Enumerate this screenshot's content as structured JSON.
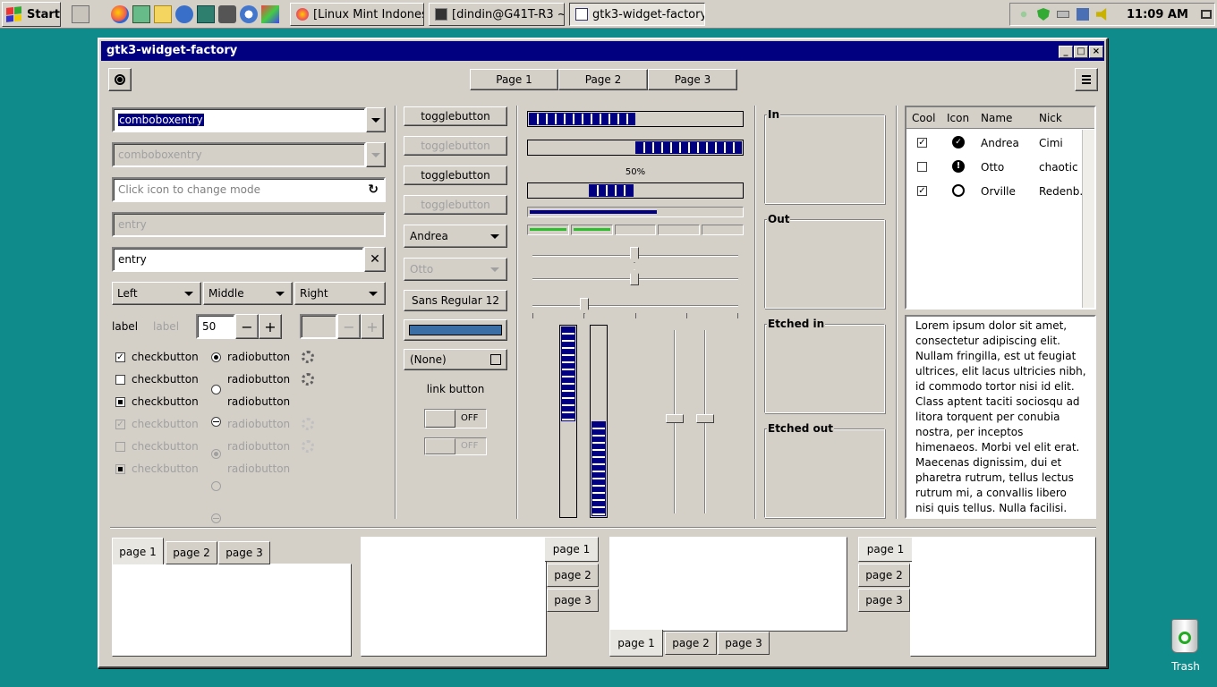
{
  "taskbar": {
    "start_label": "Start",
    "tasks": [
      {
        "label": "[Linux Mint Indonesi..."
      },
      {
        "label": "[dindin@G41T-R3 ~]"
      },
      {
        "label": "gtk3-widget-factory"
      }
    ],
    "clock": "11:09 AM"
  },
  "window": {
    "title": "gtk3-widget-factory",
    "header_tabs": [
      "Page 1",
      "Page 2",
      "Page 3"
    ]
  },
  "col1": {
    "combo1_value": "comboboxentry",
    "combo2_value": "comboboxentry",
    "entry_placeholder": "Click icon to change mode",
    "entry_disabled": "entry",
    "entry_value": "entry",
    "combos": [
      "Left",
      "Middle",
      "Right"
    ],
    "label1": "label",
    "label2": "label",
    "spin_value": "50",
    "minus": "−",
    "plus": "+",
    "checkbutton": "checkbutton",
    "radiobutton": "radiobutton"
  },
  "col2": {
    "toggle": "togglebutton",
    "combo_andrea": "Andrea",
    "combo_otto": "Otto",
    "font_name": "Sans Regular",
    "font_size": "12",
    "file_chooser": "(None)",
    "link": "link button",
    "switch_off": "OFF"
  },
  "progress": {
    "bar1": 0.5,
    "bar2": 0.5,
    "bar3_label": "50%",
    "level_fraction": 0.6,
    "vbar1": 0.5,
    "vbar2": 0.5
  },
  "frames": [
    "In",
    "Out",
    "Etched in",
    "Etched out"
  ],
  "tree": {
    "headers": [
      "Cool",
      "Icon",
      "Name",
      "Nick"
    ],
    "rows": [
      {
        "cool": true,
        "name": "Andrea",
        "nick": "Cimi"
      },
      {
        "cool": false,
        "name": "Otto",
        "nick": "chaotic"
      },
      {
        "cool": true,
        "name": "Orville",
        "nick": "Redenb..."
      }
    ]
  },
  "textview": "Lorem ipsum dolor sit amet, consectetur adipiscing elit. Nullam fringilla, est ut feugiat ultrices, elit lacus ultricies nibh, id commodo tortor nisi id elit. Class aptent taciti sociosqu ad litora torquent per conubia nostra, per inceptos himenaeos. Morbi vel elit erat. Maecenas dignissim, dui et pharetra rutrum, tellus lectus rutrum mi, a convallis libero nisi quis tellus. Nulla facilisi. Nullam eleifend",
  "notebook_tabs": [
    "page 1",
    "page 2",
    "page 3"
  ],
  "desktop": {
    "trash": "Trash"
  }
}
